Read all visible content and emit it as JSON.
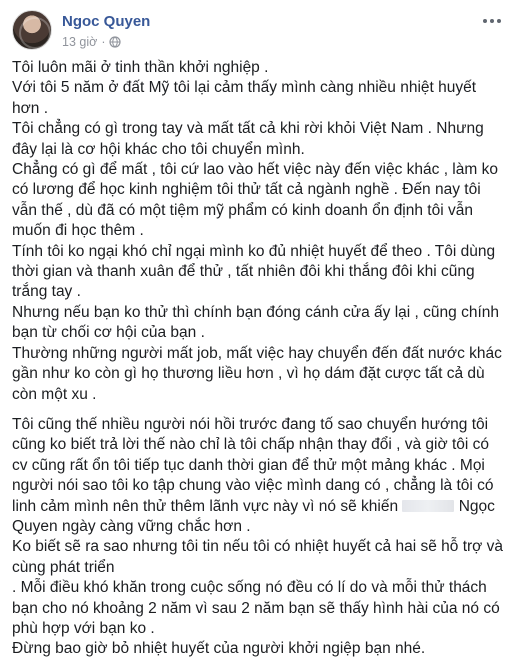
{
  "post": {
    "author": "Ngoc Quyen",
    "time": "13 giờ",
    "privacy_icon": "globe-icon",
    "more_icon": "more-horizontal-icon",
    "paragraphs": [
      "Tôi luôn mãi ở tinh thần khởi nghiệp .",
      "Với tôi 5 năm ở đất Mỹ tôi lại cảm thấy mình càng nhiều nhiệt huyết hơn .",
      "Tôi chẳng có gì trong tay và mất tất cả khi rời khỏi Việt Nam . Nhưng đây lại là cơ hội khác cho tôi chuyển mình.",
      "Chẳng có gì để mất , tôi cứ lao vào hết việc này đến việc khác , làm ko có lương để học kinh nghiệm tôi thử tất cả ngành nghề . Đến nay tôi vẫn thế , dù đã có một tiệm mỹ phẩm có kinh doanh ổn định tôi vẫn muốn đi học thêm .",
      "Tính tôi ko ngại khó chỉ ngại mình ko đủ nhiệt huyết để theo . Tôi dùng thời gian và thanh xuân để thử , tất nhiên đôi khi thắng đôi khi cũng trắng tay .",
      "Nhưng nếu bạn ko thử thì chính bạn đóng cánh cửa ấy lại , cũng chính bạn từ chối cơ hội của bạn .",
      "Thường những người mất job, mất việc hay chuyển đến đất nước khác gần như ko còn gì họ thương liều hơn , vì họ dám đặt cược tất cả dù còn một xu .",
      "Tôi cũng thế nhiều người nói hồi trước đang tố sao chuyển hướng tôi cũng ko biết trả lời thế nào chỉ là tôi chấp nhận thay đổi , và giờ tôi có cv cũng rất ổn tôi tiếp tục danh thời gian để thử một mảng khác . Mọi người nói sao tôi ko tập chung vào việc mình dang có , chẳng là tôi có linh cảm mình nên thử thêm lãnh vực này vì nó sẽ khiến",
      "Ngọc Quyen ngày càng vững chắc hơn .",
      "Ko biết sẽ ra sao nhưng tôi tin nếu tôi có nhiệt huyết cả hai sẽ hỗ trợ và cùng phát triển",
      ". Mỗi điều khó khăn trong cuộc sống nó đều có lí do và mỗi thử thách bạn cho nó khoảng 2 năm vì sau 2 năm bạn sẽ thấy hình hài của nó có phù hợp với bạn ko .",
      "Đừng bao giờ bỏ nhiệt huyết của người khởi ngiệp bạn nhé."
    ]
  }
}
